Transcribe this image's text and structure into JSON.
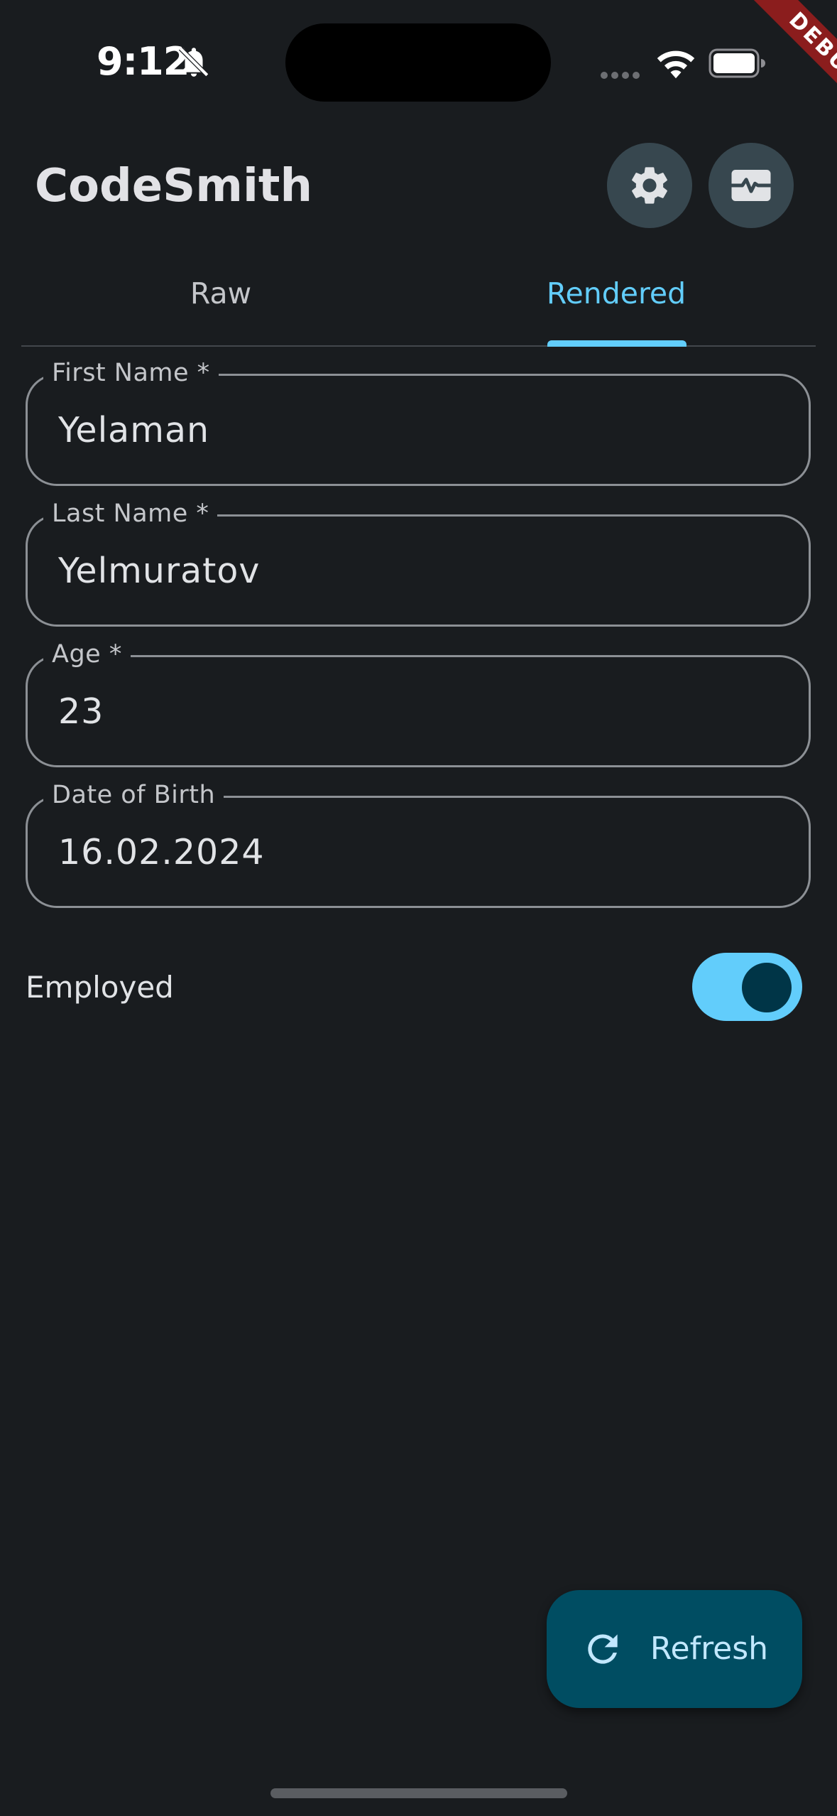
{
  "status_bar": {
    "time": "9:12",
    "icons": [
      "bell-slash-icon",
      "signal-dots-icon",
      "wifi-icon",
      "battery-icon"
    ],
    "debug_banner": "DEBUG"
  },
  "app_bar": {
    "title": "CodeSmith",
    "actions": [
      "gear-icon",
      "monitor-heart-icon"
    ]
  },
  "tabs": [
    {
      "label": "Raw",
      "selected": false
    },
    {
      "label": "Rendered",
      "selected": true
    }
  ],
  "form": {
    "first_name": {
      "label": "First Name *",
      "value": "Yelaman"
    },
    "last_name": {
      "label": "Last Name *",
      "value": "Yelmuratov"
    },
    "age": {
      "label": "Age *",
      "value": "23"
    },
    "date_of_birth": {
      "label": "Date of Birth",
      "value": "16.02.2024"
    },
    "employed": {
      "label": "Employed",
      "checked": true
    }
  },
  "fab": {
    "label": "Refresh",
    "icon": "refresh-icon"
  },
  "colors": {
    "background": "#191c1f",
    "accent": "#62cdfb",
    "fab_background": "#004d62",
    "icon_button_background": "#37474f",
    "debug_banner": "#8b1d1d"
  }
}
